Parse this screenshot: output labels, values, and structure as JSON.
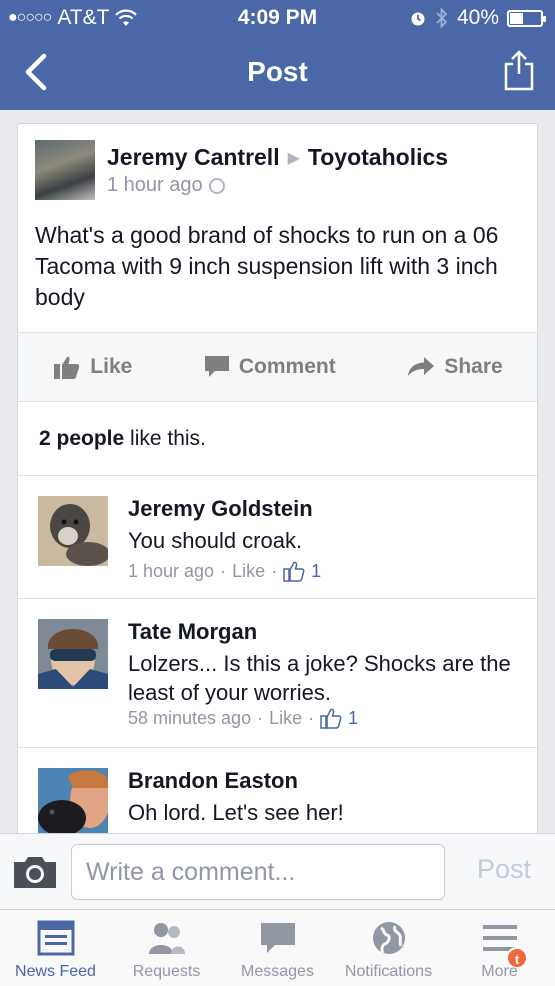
{
  "status_bar": {
    "carrier": "AT&T",
    "time": "4:09 PM",
    "battery": "40%",
    "battery_level": 0.4
  },
  "navbar": {
    "title": "Post"
  },
  "post": {
    "author": "Jeremy Cantrell",
    "group": "Toyotaholics",
    "time": "1 hour ago",
    "text": "What's a good brand of shocks to run on a 06 Tacoma with 9 inch suspension lift with 3 inch body",
    "actions": {
      "like": "Like",
      "comment": "Comment",
      "share": "Share"
    },
    "likes_count": "2 people",
    "likes_suffix": " like this."
  },
  "comments": [
    {
      "name": "Jeremy Goldstein",
      "text": "You should croak.",
      "time": "1 hour ago",
      "like_label": "Like",
      "like_count": "1"
    },
    {
      "name": "Tate Morgan",
      "text": "Lolzers... Is this a joke?  Shocks are the least of your worries.",
      "time": "58 minutes ago",
      "like_label": "Like",
      "like_count": "1"
    },
    {
      "name": "Brandon Easton",
      "text": "Oh lord. Let's see her!"
    }
  ],
  "composer": {
    "placeholder": "Write a comment...",
    "post_label": "Post"
  },
  "tabs": [
    {
      "label": "News Feed",
      "icon": "news-feed-icon",
      "active": true
    },
    {
      "label": "Requests",
      "icon": "requests-icon"
    },
    {
      "label": "Messages",
      "icon": "messages-icon"
    },
    {
      "label": "Notifications",
      "icon": "globe-icon"
    },
    {
      "label": "More",
      "icon": "menu-icon",
      "badge": "t"
    }
  ],
  "colors": {
    "brand": "#4a67a8",
    "badge": "#f0673a"
  }
}
